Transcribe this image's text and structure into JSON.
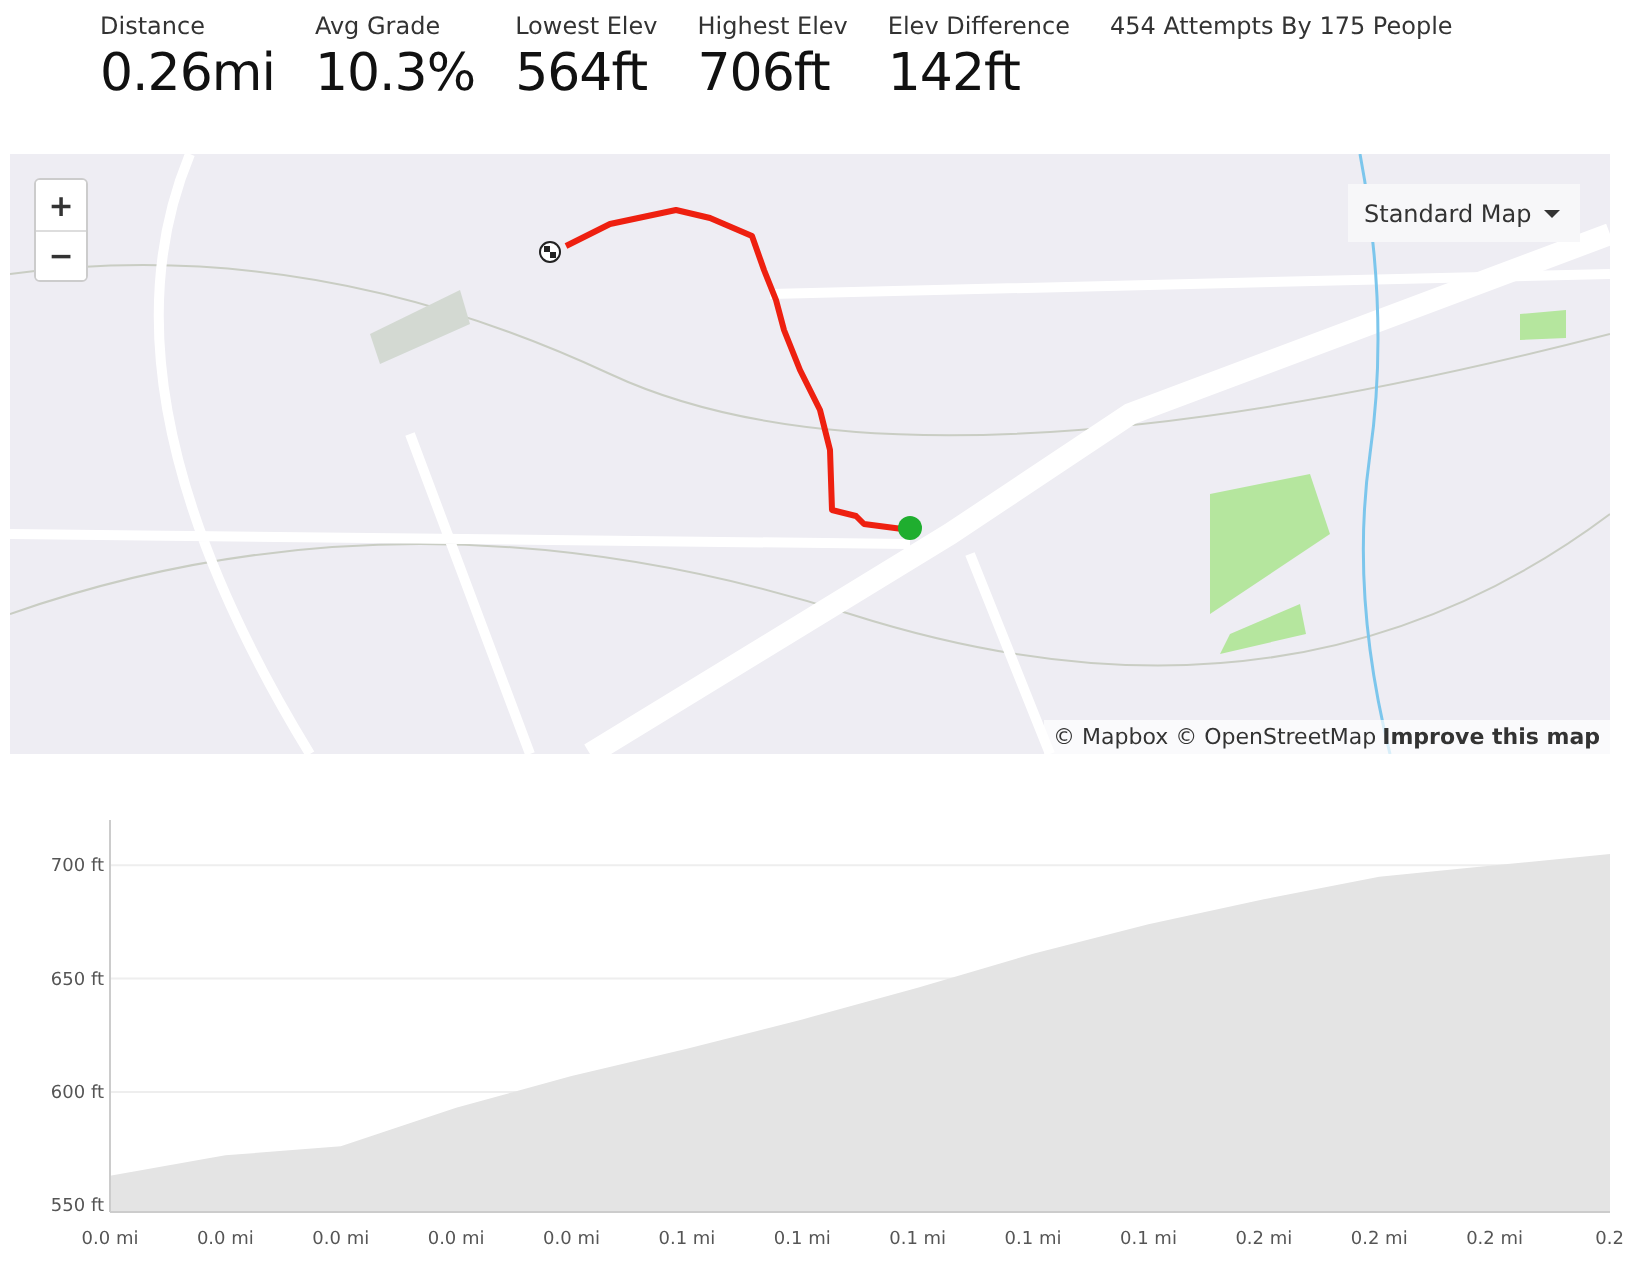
{
  "stats": [
    {
      "label": "Distance",
      "value": "0.26mi"
    },
    {
      "label": "Avg Grade",
      "value": "10.3%"
    },
    {
      "label": "Lowest Elev",
      "value": "564ft"
    },
    {
      "label": "Highest Elev",
      "value": "706ft"
    },
    {
      "label": "Elev Difference",
      "value": "142ft"
    }
  ],
  "attempts": "454 Attempts By 175 People",
  "map": {
    "zoom_in": "+",
    "zoom_out": "−",
    "style_menu": "Standard Map",
    "attribution": "© Mapbox © OpenStreetMap",
    "improve_link": "Improve this map"
  },
  "elevation_chart": {
    "chart_data": {
      "type": "area",
      "categories": [
        "0.0 mi",
        "0.0 mi",
        "0.0 mi",
        "0.0 mi",
        "0.0 mi",
        "0.1 mi",
        "0.1 mi",
        "0.1 mi",
        "0.1 mi",
        "0.1 mi",
        "0.2 mi",
        "0.2 mi",
        "0.2 mi",
        "0.2"
      ],
      "grid": true,
      "series": [
        {
          "color": "#e4e4e4",
          "values": [
            563,
            572,
            576,
            593,
            607,
            619,
            632,
            646,
            661,
            674,
            685,
            695,
            700,
            705
          ]
        }
      ],
      "ylim": [
        547,
        720
      ],
      "yticks": [
        {
          "value": 550,
          "label": "550 ft"
        },
        {
          "value": 600,
          "label": "600 ft"
        },
        {
          "value": 650,
          "label": "650 ft"
        },
        {
          "value": 700,
          "label": "700 ft"
        }
      ]
    }
  }
}
